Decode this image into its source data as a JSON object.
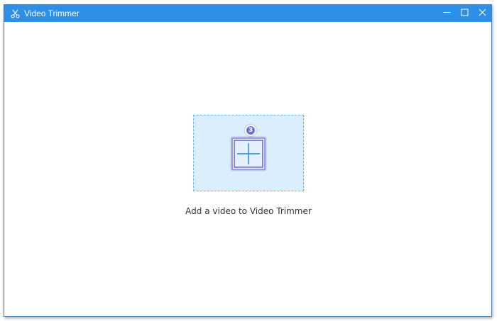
{
  "window": {
    "title": "Video Trimmer",
    "app_icon": "scissors-icon",
    "controls": {
      "minimize_icon": "minimize-icon",
      "maximize_icon": "maximize-icon",
      "close_icon": "close-icon"
    }
  },
  "main": {
    "drop_zone": {
      "add_icon": "plus-icon",
      "badge_count": "3"
    },
    "caption": "Add a video to Video Trimmer"
  },
  "colors": {
    "titlebar": "#2e8fe6",
    "drop_zone_bg": "#dbeefe",
    "drop_zone_border": "#6fb2ee",
    "badge": "#6b6fd6"
  }
}
